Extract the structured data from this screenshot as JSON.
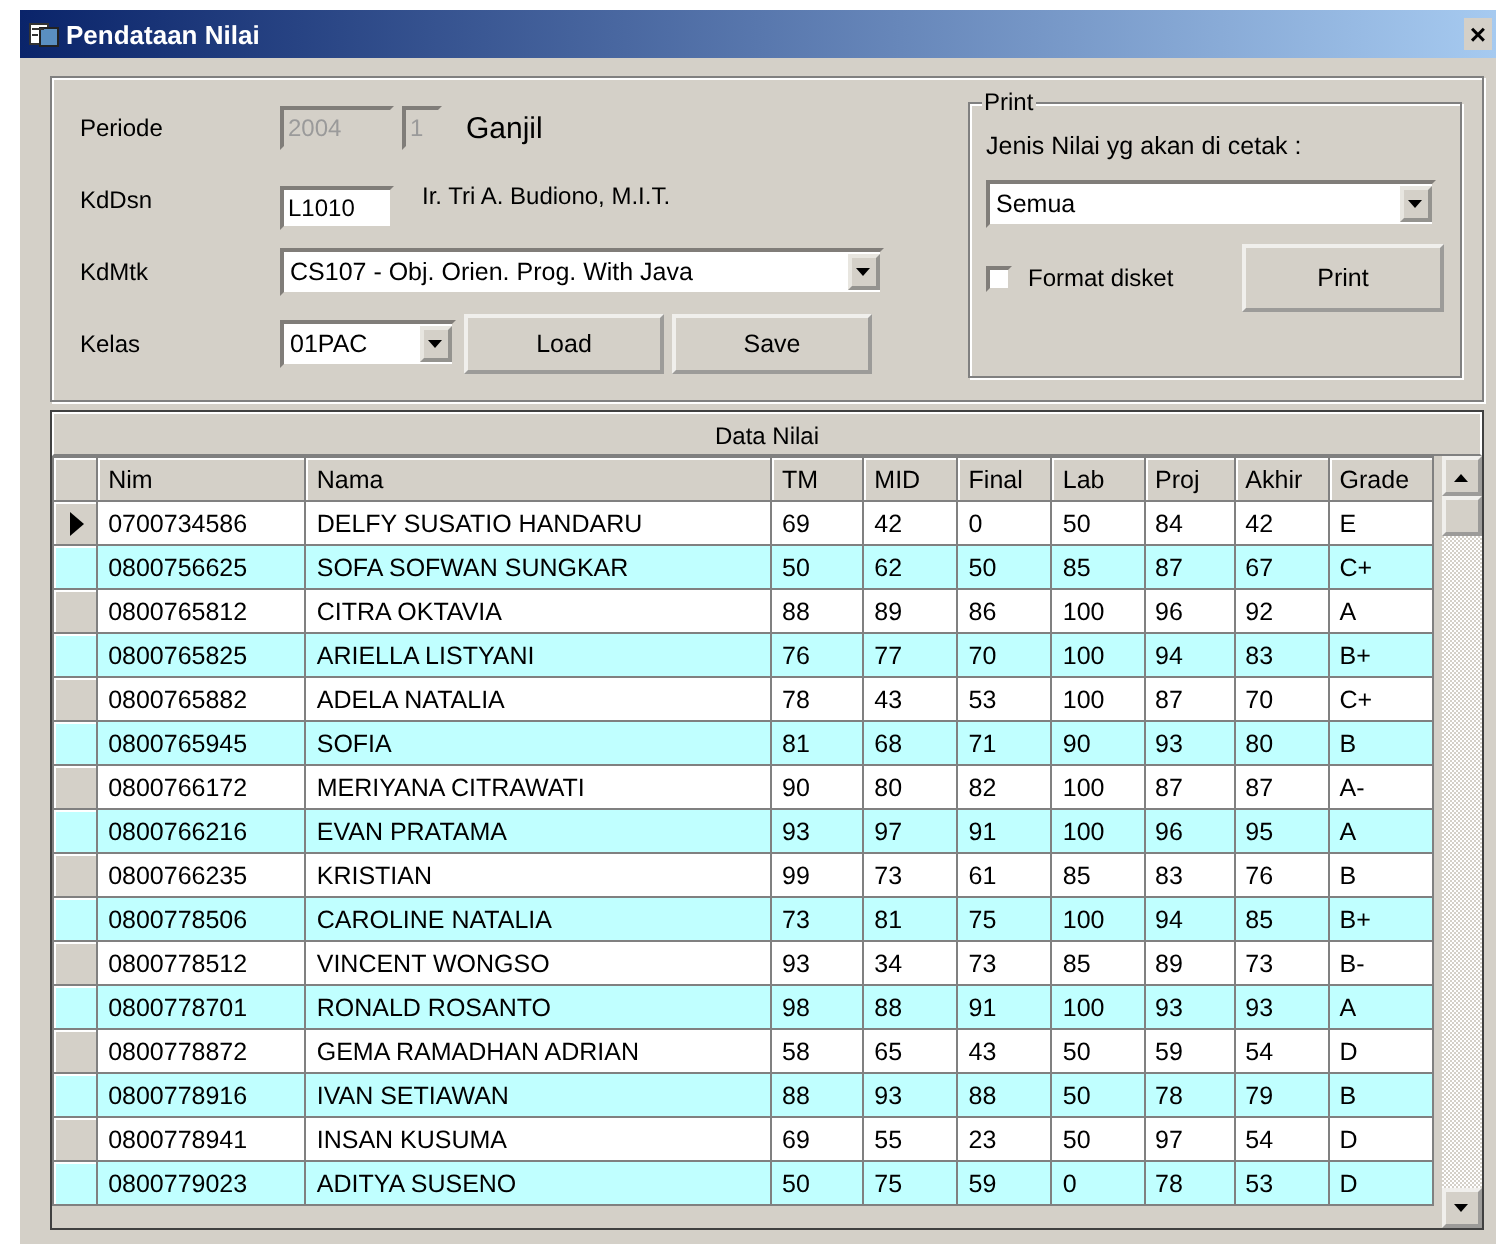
{
  "window": {
    "title": "Pendataan Nilai",
    "close": "×"
  },
  "form": {
    "periode_label": "Periode",
    "year": "2004",
    "semester": "1",
    "semester_name": "Ganjil",
    "kddsn_label": "KdDsn",
    "kddsn": "L1010",
    "dosen_name": "Ir. Tri A. Budiono, M.I.T.",
    "kdmtk_label": "KdMtk",
    "kdmtk": "CS107 - Obj. Orien. Prog. With Java",
    "kelas_label": "Kelas",
    "kelas": "01PAC",
    "load_button": "Load",
    "save_button": "Save"
  },
  "print": {
    "legend": "Print",
    "jenis_label": "Jenis Nilai yg akan di cetak :",
    "jenis": "Semua",
    "format_disket": {
      "label": "Format disket",
      "checked": false
    },
    "print_button": "Print"
  },
  "table": {
    "title": "Data Nilai",
    "columns": [
      "Nim",
      "Nama",
      "TM",
      "MID",
      "Final",
      "Lab",
      "Proj",
      "Akhir",
      "Grade"
    ],
    "rows": [
      {
        "selected": true,
        "cells": [
          "0700734586",
          "DELFY SUSATIO HANDARU",
          "69",
          "42",
          "0",
          "50",
          "84",
          "42",
          "E"
        ]
      },
      {
        "selected": false,
        "cells": [
          "0800756625",
          "SOFA SOFWAN SUNGKAR",
          "50",
          "62",
          "50",
          "85",
          "87",
          "67",
          "C+"
        ]
      },
      {
        "selected": false,
        "cells": [
          "0800765812",
          "CITRA OKTAVIA",
          "88",
          "89",
          "86",
          "100",
          "96",
          "92",
          "A"
        ]
      },
      {
        "selected": false,
        "cells": [
          "0800765825",
          "ARIELLA LISTYANI",
          "76",
          "77",
          "70",
          "100",
          "94",
          "83",
          "B+"
        ]
      },
      {
        "selected": false,
        "cells": [
          "0800765882",
          "ADELA NATALIA",
          "78",
          "43",
          "53",
          "100",
          "87",
          "70",
          "C+"
        ]
      },
      {
        "selected": false,
        "cells": [
          "0800765945",
          "SOFIA",
          "81",
          "68",
          "71",
          "90",
          "93",
          "80",
          "B"
        ]
      },
      {
        "selected": false,
        "cells": [
          "0800766172",
          "MERIYANA CITRAWATI",
          "90",
          "80",
          "82",
          "100",
          "87",
          "87",
          "A-"
        ]
      },
      {
        "selected": false,
        "cells": [
          "0800766216",
          "EVAN PRATAMA",
          "93",
          "97",
          "91",
          "100",
          "96",
          "95",
          "A"
        ]
      },
      {
        "selected": false,
        "cells": [
          "0800766235",
          "KRISTIAN",
          "99",
          "73",
          "61",
          "85",
          "83",
          "76",
          "B"
        ]
      },
      {
        "selected": false,
        "cells": [
          "0800778506",
          "CAROLINE NATALIA",
          "73",
          "81",
          "75",
          "100",
          "94",
          "85",
          "B+"
        ]
      },
      {
        "selected": false,
        "cells": [
          "0800778512",
          "VINCENT WONGSO",
          "93",
          "34",
          "73",
          "85",
          "89",
          "73",
          "B-"
        ]
      },
      {
        "selected": false,
        "cells": [
          "0800778701",
          "RONALD ROSANTO",
          "98",
          "88",
          "91",
          "100",
          "93",
          "93",
          "A"
        ]
      },
      {
        "selected": false,
        "cells": [
          "0800778872",
          "GEMA RAMADHAN ADRIAN",
          "58",
          "65",
          "43",
          "50",
          "59",
          "54",
          "D"
        ]
      },
      {
        "selected": false,
        "cells": [
          "0800778916",
          "IVAN SETIAWAN",
          "88",
          "93",
          "88",
          "50",
          "78",
          "79",
          "B"
        ]
      },
      {
        "selected": false,
        "cells": [
          "0800778941",
          "INSAN KUSUMA",
          "69",
          "55",
          "23",
          "50",
          "97",
          "54",
          "D"
        ]
      },
      {
        "selected": false,
        "cells": [
          "0800779023",
          "ADITYA SUSENO",
          "50",
          "75",
          "59",
          "0",
          "78",
          "53",
          "D"
        ]
      }
    ]
  }
}
